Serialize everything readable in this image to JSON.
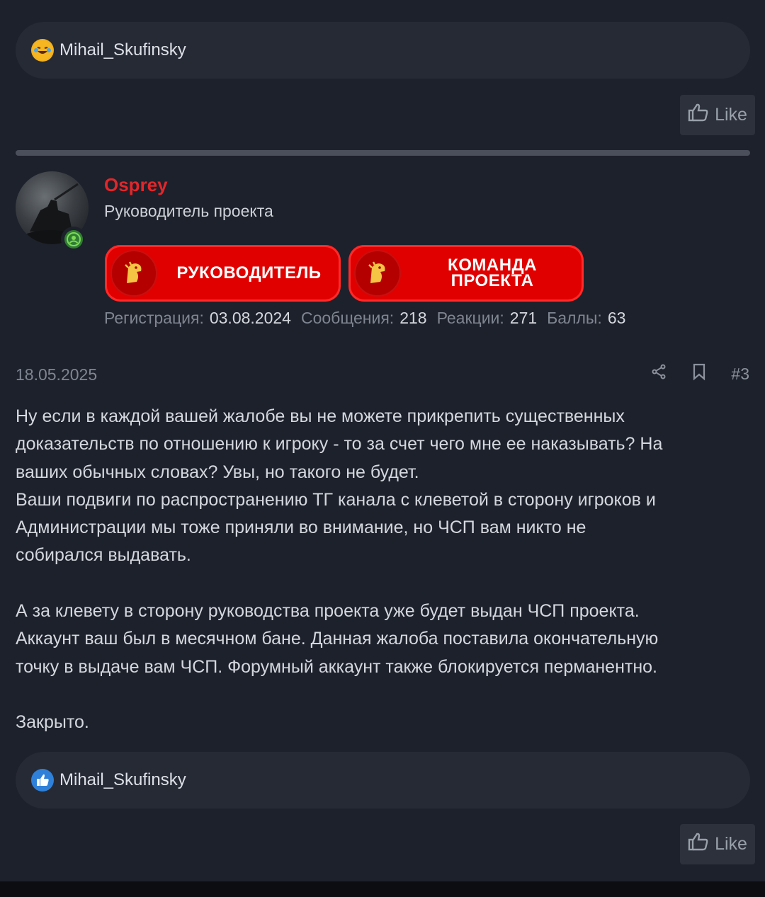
{
  "top_reactions": {
    "users": "Mihail_Skufinsky",
    "icon": "laughing-emoji-icon"
  },
  "like_label": "Like",
  "author": {
    "name": "Osprey",
    "title": "Руководитель проекта",
    "name_color": "#e3262a",
    "banners": [
      {
        "text_line1": "РУКОВОДИТЕЛЬ",
        "text_line2": ""
      },
      {
        "text_line1": "КОМАНДА",
        "text_line2": "ПРОЕКТА"
      }
    ],
    "stats": {
      "registration_label": "Регистрация:",
      "registration": "03.08.2024",
      "messages_label": "Сообщения:",
      "messages": "218",
      "reactions_label": "Реакции:",
      "reactions": "271",
      "points_label": "Баллы:",
      "points": "63"
    }
  },
  "post": {
    "date": "18.05.2025",
    "number": "#3",
    "body": "Ну если в каждой вашей жалобе вы не можете прикрепить существенных\nдоказательств по отношению к игроку - то за счет чего мне ее наказывать? На\nваших обычных словах? Увы, но такого не будет.\nВаши подвиги по распространению ТГ канала с клеветой в сторону игроков и\nАдминистрации мы тоже приняли во внимание, но ЧСП вам никто не\nсобирался выдавать.\n\nА за клевету в сторону руководства проекта уже будет выдан ЧСП проекта.\nАккаунт ваш был в месячном бане. Данная жалоба поставила окончательную\nточку в выдаче вам ЧСП. Форумный аккаунт также блокируется перманентно.\n\nЗакрыто.",
    "reactions": {
      "users": "Mihail_Skufinsky",
      "icon": "like-reaction-icon"
    }
  }
}
